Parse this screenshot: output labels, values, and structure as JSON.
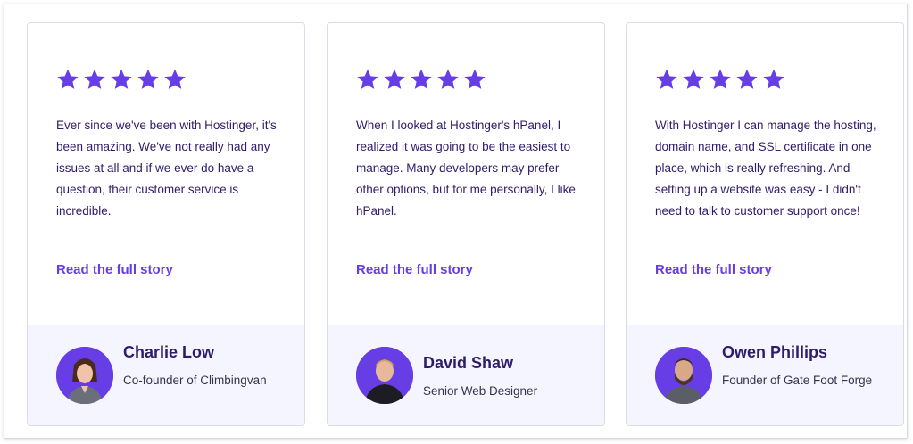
{
  "colors": {
    "accent": "#673de6",
    "star": "#673de6",
    "text": "#2f1c6a",
    "footer_bg": "#f4f5ff"
  },
  "testimonials": [
    {
      "rating": 5,
      "quote": "Ever since we've been with Hostinger, it's been amazing. We've not really had any issues at all and if we ever do have a question, their customer service is incredible.",
      "link_label": "Read the full story",
      "name": "Charlie Low",
      "role": "Co-founder of Climbingvan"
    },
    {
      "rating": 5,
      "quote": "When I looked at Hostinger's hPanel, I realized it was going to be the easiest to manage. Many developers may prefer other options, but for me personally, I like hPanel.",
      "link_label": "Read the full story",
      "name": "David Shaw",
      "role": "Senior Web Designer"
    },
    {
      "rating": 5,
      "quote": "With Hostinger I can manage the hosting, domain name, and SSL certificate in one place, which is really refreshing. And setting up a website was easy - I didn't need to talk to customer support once!",
      "link_label": "Read the full story",
      "name": "Owen Phillips",
      "role": "Founder of Gate Foot Forge"
    }
  ]
}
